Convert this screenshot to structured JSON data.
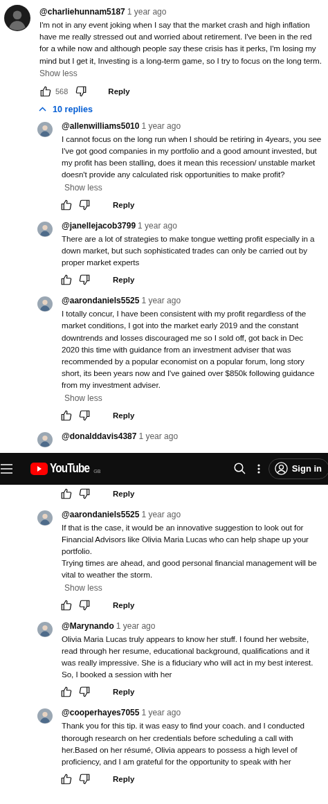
{
  "comment": {
    "author": "@charliehunnam5187",
    "time": "1 year ago",
    "text": "I'm not in any event joking when I say that the market crash and high inflation have me really stressed out and worried about retirement. I've been in the red for a while now and although people say these crisis has it perks, I'm losing my mind but I get it, Investing is a long-term game, so I try to focus on the long term.",
    "toggle": "Show less",
    "likes": "568",
    "reply": "Reply"
  },
  "replies_toggle": {
    "label": "10 replies",
    "expanded": true
  },
  "replies": [
    {
      "kind": "full",
      "author": "@allenwilliams5010",
      "time": "1 year ago",
      "text": "I cannot focus on the long run when I should be retiring in 4years, you see I've got good companies in my portfolio and a good amount invested, but my profit has been stalling, does it mean this recession/ unstable market doesn't provide any calculated risk opportunities to make profit?",
      "toggle": "Show less",
      "reply": "Reply"
    },
    {
      "kind": "full",
      "author": "@janellejacob3799",
      "time": "1 year ago",
      "text": "There are a lot of strategies to make tongue wetting profit especially in a down market, but such sophisticated trades can only be carried out by proper market experts",
      "reply": "Reply"
    },
    {
      "kind": "full",
      "author": "@aarondaniels5525",
      "time": "1 year ago",
      "text": "I totally concur, I have been consistent with my profit regardless of the market conditions, I got into the market early 2019 and the constant downtrends and losses discouraged me so I sold off, got back in Dec 2020 this time with guidance from an investment adviser that was recommended by a popular economist on a popular forum, long story short, its been years now and I've gained over $850k following guidance from my investment adviser.",
      "toggle": "Show less",
      "reply": "Reply"
    },
    {
      "kind": "covered",
      "author": "@donalddavis4387",
      "time": "1 year ago",
      "reply": "Reply"
    },
    {
      "kind": "full",
      "author": "@aarondaniels5525",
      "time": "1 year ago",
      "text": "If that is the case, it would be an innovative suggestion to look out for Financial Advisors like Olivia Maria Lucas who can help shape up your portfolio.\nTrying times are ahead, and good personal financial management will be vital to weather the storm.",
      "toggle": "Show less",
      "reply": "Reply"
    },
    {
      "kind": "full",
      "author": "@Marynando",
      "time": "1 year ago",
      "text": "Olivia Maria Lucas truly appears to know her stuff. I found her website, read through her resume, educational background, qualifications and it was really impressive. She is a fiduciary who will act in my best interest. So, I booked a session with her",
      "reply": "Reply"
    },
    {
      "kind": "full",
      "author": "@cooperhayes7055",
      "time": "1 year ago",
      "text": "Thank you for this tip. it was easy to find your coach. and I conducted thorough research on her credentials before scheduling a call with her.Based on her résumé, Olivia appears to possess a high level of proficiency, and I am grateful for the opportunity to speak with her",
      "reply": "Reply"
    }
  ],
  "masthead": {
    "logo": "YouTube",
    "region": "GB",
    "sign_in": "Sign in"
  }
}
